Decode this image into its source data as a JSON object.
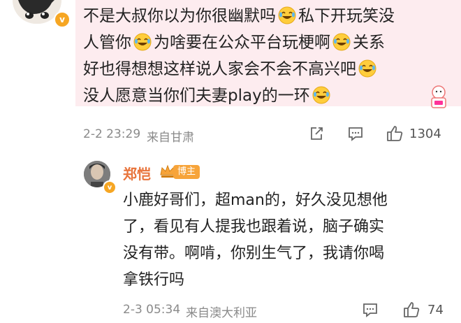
{
  "comment": {
    "text_lines": [
      "不是大叔你以为你很幽默吗",
      "私下开玩笑没",
      "人管你",
      "为啥要在公众平台玩梗啊",
      "关系",
      "好也得想想这样说人家会不会不高兴吧",
      "没人愿意当你们夫妻play的一环"
    ],
    "date": "2-2 23:29",
    "source": "来自甘肃",
    "likes": "1304",
    "badge_letter": "v"
  },
  "reply": {
    "username": "郑恺",
    "owner_tag": "博主",
    "text_lines": [
      "小鹿好哥们，超man的，好久没见想他",
      "了，看见有人提我也跟着说，脑子确实",
      "没有带。啊啃，你别生气了，我请你喝",
      "拿铁行吗"
    ],
    "date": "2-3 05:34",
    "source": "来自澳大利亚",
    "likes": "74",
    "badge_letter": "v"
  },
  "colors": {
    "bubble_bg": "#fdecef",
    "username": "#e8733a",
    "owner_tag_bg": "#f7a43a",
    "meta_text": "#8a8a8a",
    "verified_badge": "#f6a623"
  },
  "icons": [
    "laughing-crying-emoji",
    "share-icon",
    "comment-icon",
    "like-icon",
    "vip-crown-icon",
    "verified-badge-icon",
    "cartoon-sticker"
  ]
}
